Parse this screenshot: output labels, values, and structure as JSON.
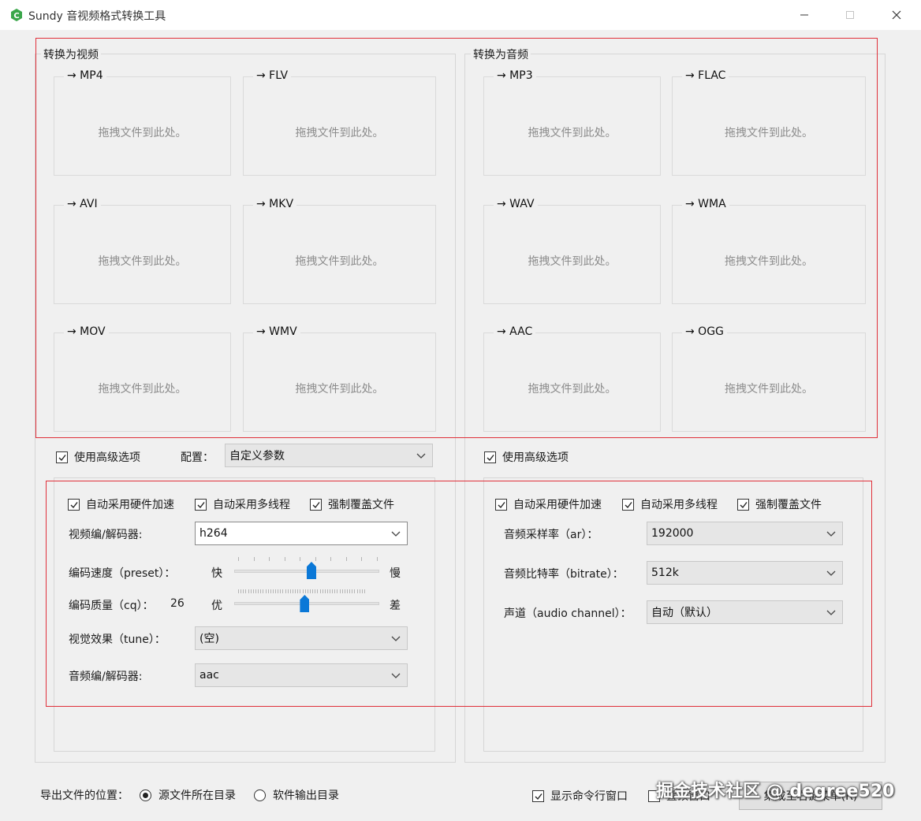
{
  "window": {
    "title": "Sundy 音视频格式转换工具"
  },
  "video_section": {
    "title": "转换为视频",
    "targets": [
      {
        "label": "→ MP4",
        "hint": "拖拽文件到此处。"
      },
      {
        "label": "→ FLV",
        "hint": "拖拽文件到此处。"
      },
      {
        "label": "→ AVI",
        "hint": "拖拽文件到此处。"
      },
      {
        "label": "→ MKV",
        "hint": "拖拽文件到此处。"
      },
      {
        "label": "→ MOV",
        "hint": "拖拽文件到此处。"
      },
      {
        "label": "→ WMV",
        "hint": "拖拽文件到此处。"
      }
    ],
    "advanced_label": "使用高级选项",
    "config_label": "配置：",
    "config_value": "自定义参数",
    "options": {
      "hw_accel": "自动采用硬件加速",
      "multithread": "自动采用多线程",
      "overwrite": "强制覆盖文件",
      "video_codec_label": "视频编/解码器:",
      "video_codec_value": "h264",
      "preset_label": "编码速度（preset）：",
      "preset_fast": "快",
      "preset_slow": "慢",
      "preset_level": 0.5,
      "cq_label": "编码质量（cq）：",
      "cq_value": "26",
      "cq_good": "优",
      "cq_bad": "差",
      "cq_level": 0.5,
      "tune_label": "视觉效果（tune）：",
      "tune_value": "(空)",
      "audio_codec_label": "音频编/解码器:",
      "audio_codec_value": "aac"
    }
  },
  "audio_section": {
    "title": "转换为音频",
    "targets": [
      {
        "label": "→ MP3",
        "hint": "拖拽文件到此处。"
      },
      {
        "label": "→ FLAC",
        "hint": "拖拽文件到此处。"
      },
      {
        "label": "→ WAV",
        "hint": "拖拽文件到此处。"
      },
      {
        "label": "→ WMA",
        "hint": "拖拽文件到此处。"
      },
      {
        "label": "→ AAC",
        "hint": "拖拽文件到此处。"
      },
      {
        "label": "→ OGG",
        "hint": "拖拽文件到此处。"
      }
    ],
    "advanced_label": "使用高级选项",
    "options": {
      "hw_accel": "自动采用硬件加速",
      "multithread": "自动采用多线程",
      "overwrite": "强制覆盖文件",
      "sample_rate_label": "音频采样率（ar）：",
      "sample_rate_value": "192000",
      "bitrate_label": "音频比特率（bitrate）：",
      "bitrate_value": "512k",
      "channel_label": "声道（audio channel）：",
      "channel_value": "自动（默认）"
    }
  },
  "footer": {
    "output_label": "导出文件的位置：",
    "radio_source": "源文件所在目录",
    "radio_output": "软件输出目录",
    "show_cmd": "显示命令行窗口",
    "topmost": "置顶窗口",
    "context_menu_button": "集成至右键菜单(R)",
    "watermark": "掘金技术社区 @ degree520"
  }
}
